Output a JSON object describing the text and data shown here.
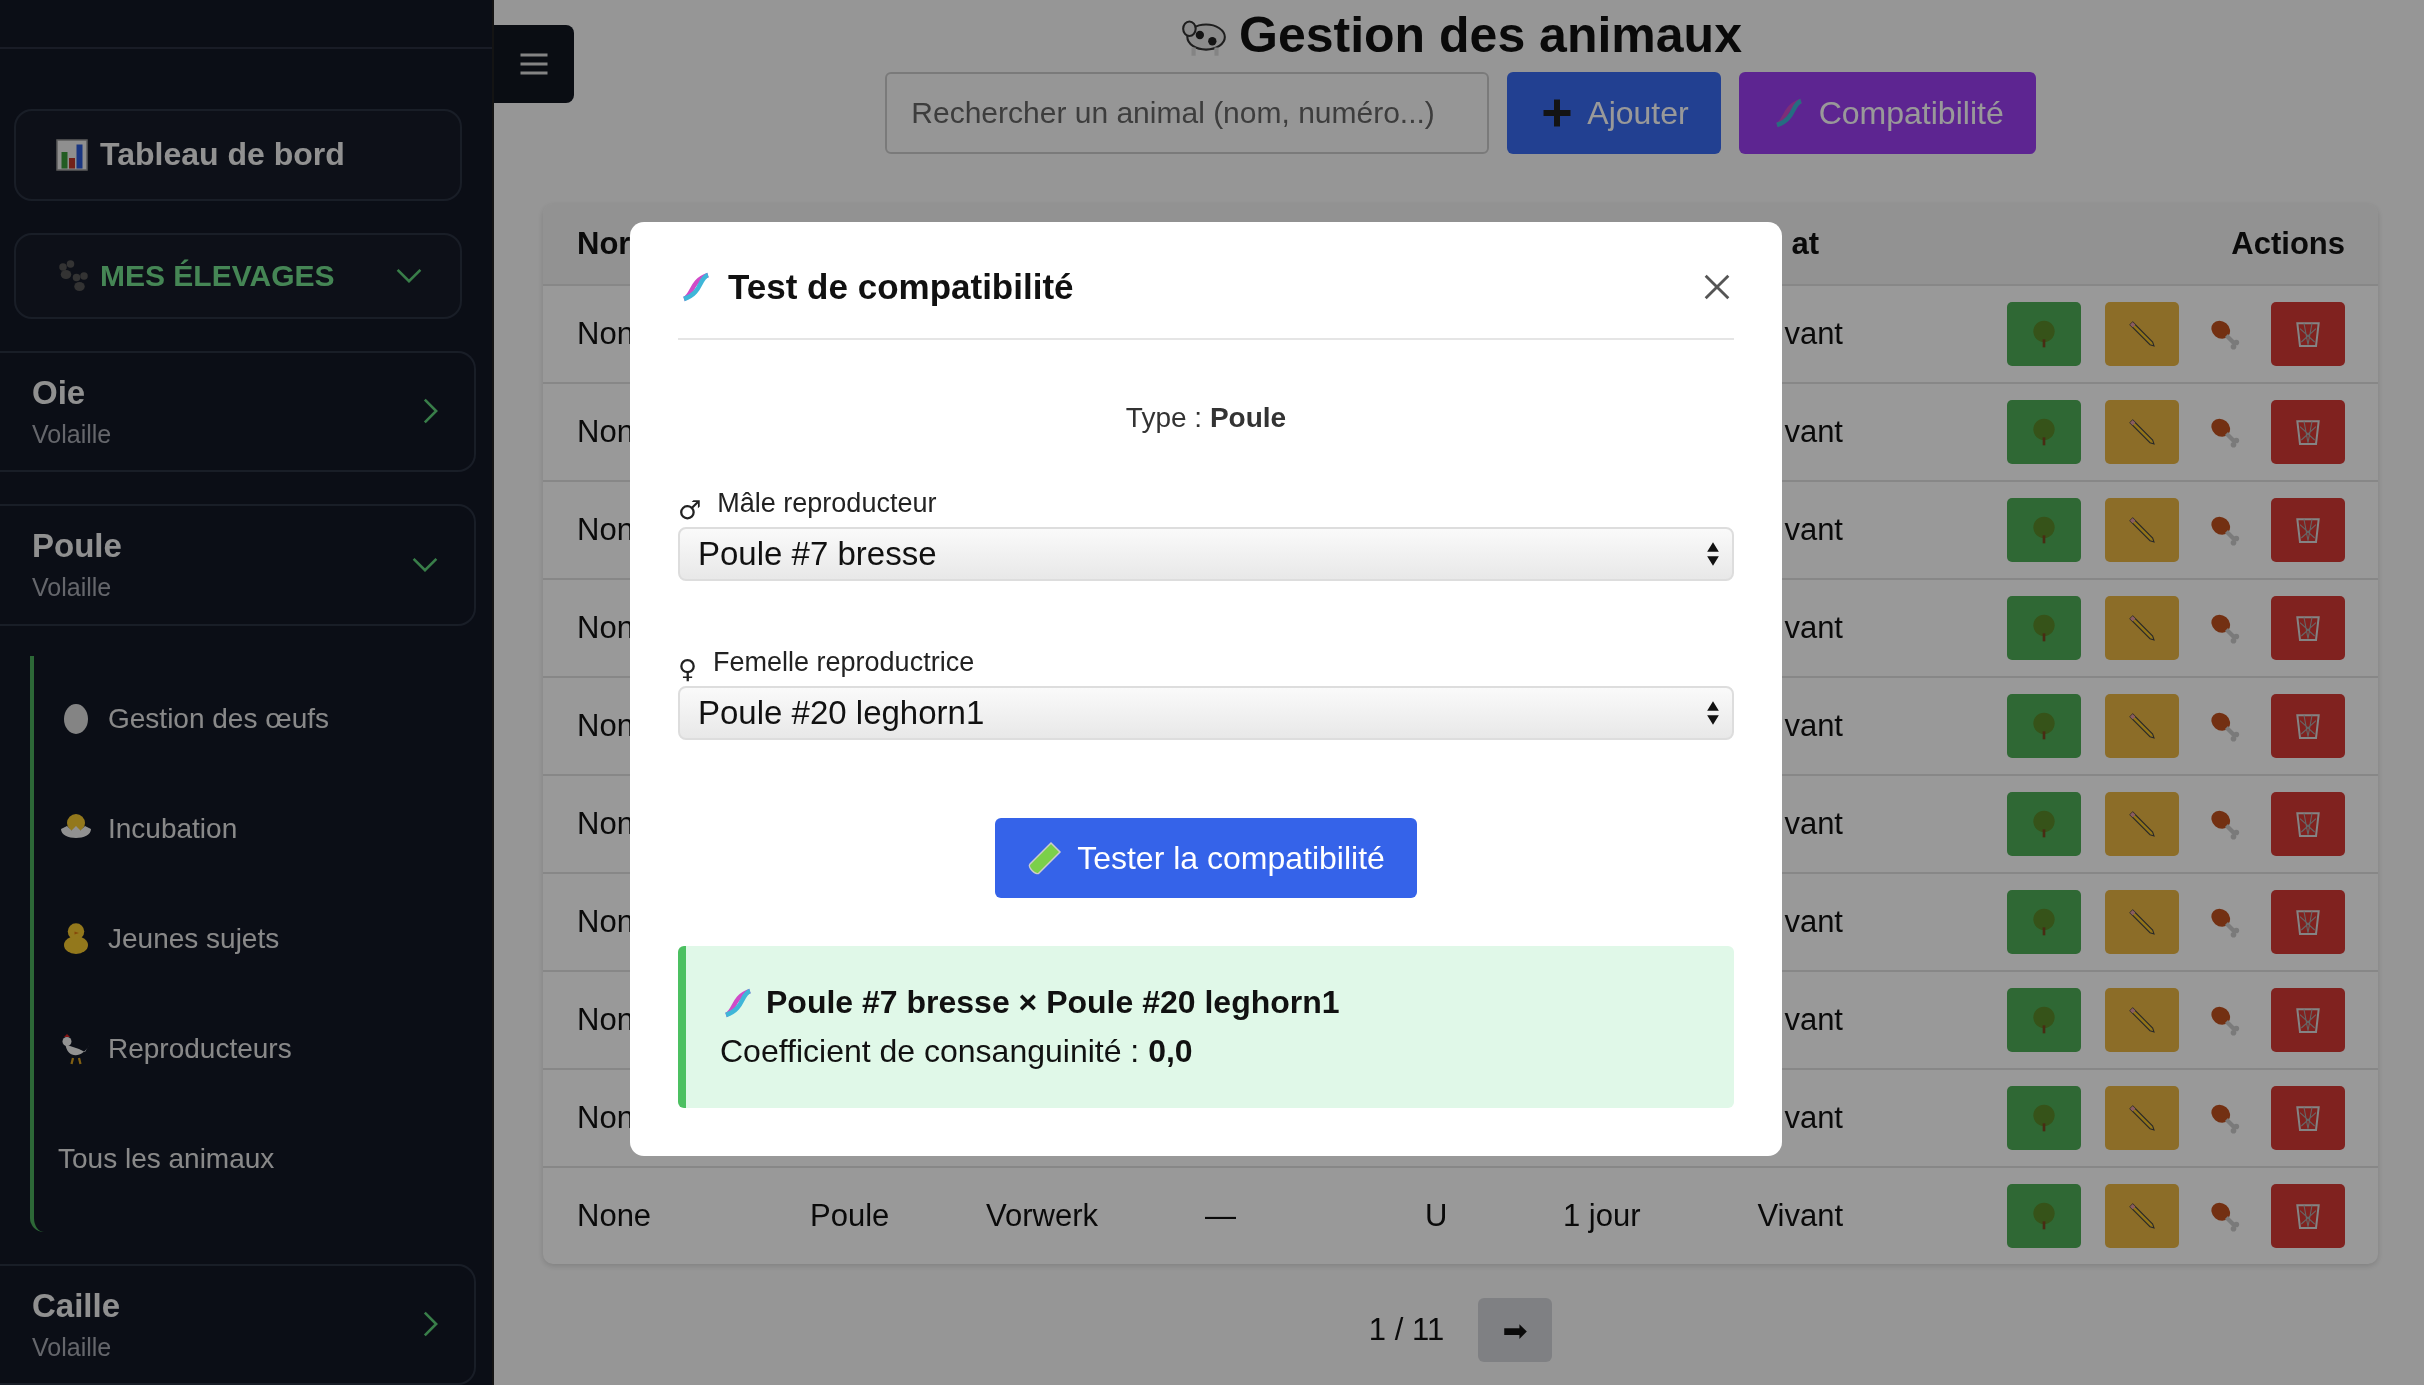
{
  "sidebar": {
    "dashboard_link": "Tableau de bord",
    "section": {
      "label": "MES ÉLEVAGES",
      "expanded": true
    },
    "groups": [
      {
        "name": "Oie",
        "category": "Volaille",
        "expanded": false
      },
      {
        "name": "Poule",
        "category": "Volaille",
        "expanded": true,
        "children": [
          {
            "label": "Gestion des œufs",
            "kind": "egg"
          },
          {
            "label": "Incubation",
            "kind": "hatching"
          },
          {
            "label": "Jeunes sujets",
            "kind": "chick"
          },
          {
            "label": "Reproducteurs",
            "kind": "rooster"
          },
          {
            "label": "Tous les animaux",
            "kind": "plain"
          }
        ]
      },
      {
        "name": "Caille",
        "category": "Volaille",
        "expanded": false
      }
    ]
  },
  "page": {
    "title": "Gestion des animaux",
    "search": {
      "placeholder": "Rechercher un animal (nom, numéro...)"
    },
    "buttons": [
      {
        "label": "Ajouter",
        "kind": "add"
      },
      {
        "label": "Compatibilité",
        "kind": "compat"
      }
    ]
  },
  "table": {
    "columns": [
      "Nor",
      null,
      null,
      null,
      null,
      null,
      "at",
      "Actions"
    ],
    "rows": [
      {
        "cells": [
          "Non",
          null,
          null,
          null,
          null,
          null,
          "vant"
        ]
      },
      {
        "cells": [
          "Non",
          null,
          null,
          null,
          null,
          null,
          "vant"
        ]
      },
      {
        "cells": [
          "Non",
          null,
          null,
          null,
          null,
          null,
          "vant"
        ]
      },
      {
        "cells": [
          "Non",
          null,
          null,
          null,
          null,
          null,
          "vant"
        ]
      },
      {
        "cells": [
          "Non",
          null,
          null,
          null,
          null,
          null,
          "vant"
        ]
      },
      {
        "cells": [
          "Non",
          null,
          null,
          null,
          null,
          null,
          "vant"
        ]
      },
      {
        "cells": [
          "Non",
          null,
          null,
          null,
          null,
          null,
          "vant"
        ]
      },
      {
        "cells": [
          "Non",
          null,
          null,
          null,
          null,
          null,
          "vant"
        ]
      },
      {
        "cells": [
          "Non",
          null,
          null,
          null,
          null,
          null,
          "vant"
        ]
      },
      {
        "cells": [
          "None",
          "Poule",
          "Vorwerk",
          "—",
          "U",
          "1 jour",
          "Vivant"
        ]
      }
    ]
  },
  "pagination": {
    "label": "1 / 11",
    "next": "➡"
  },
  "modal": {
    "title": "Test de compatibilité",
    "type_label": "Type : **Poule**",
    "fields": [
      {
        "symbol": "♂",
        "label": "Mâle reproducteur",
        "value": "Poule #7 bresse"
      },
      {
        "symbol": "♀",
        "label": "Femelle reproductrice",
        "value": "Poule #20 leghorn1"
      }
    ],
    "submit": "Tester la compatibilité",
    "result": {
      "pair": "Poule #7 bresse × Poule #20 leghorn1",
      "text": "Coefficient de consanguinité : **0,0**"
    }
  }
}
